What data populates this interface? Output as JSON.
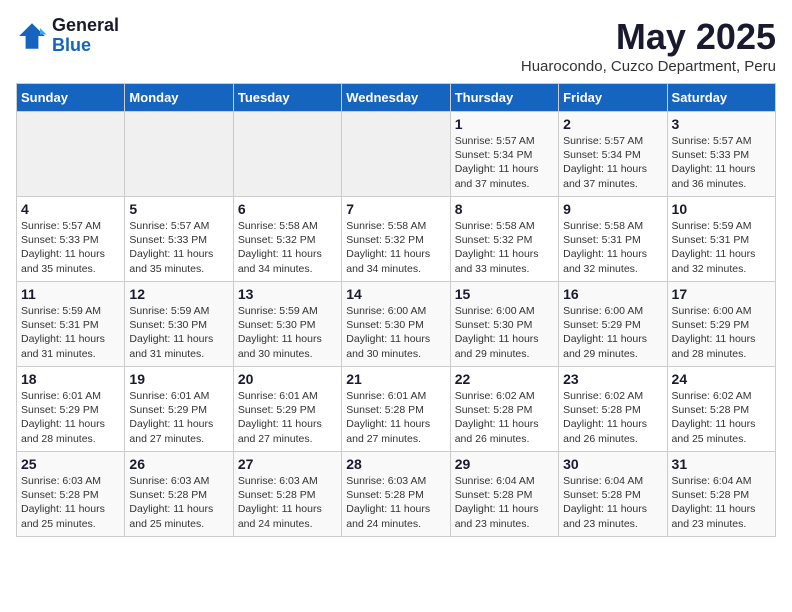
{
  "logo": {
    "general": "General",
    "blue": "Blue"
  },
  "header": {
    "month": "May 2025",
    "location": "Huarocondo, Cuzco Department, Peru"
  },
  "weekdays": [
    "Sunday",
    "Monday",
    "Tuesday",
    "Wednesday",
    "Thursday",
    "Friday",
    "Saturday"
  ],
  "weeks": [
    [
      {
        "day": "",
        "info": ""
      },
      {
        "day": "",
        "info": ""
      },
      {
        "day": "",
        "info": ""
      },
      {
        "day": "",
        "info": ""
      },
      {
        "day": "1",
        "info": "Sunrise: 5:57 AM\nSunset: 5:34 PM\nDaylight: 11 hours\nand 37 minutes."
      },
      {
        "day": "2",
        "info": "Sunrise: 5:57 AM\nSunset: 5:34 PM\nDaylight: 11 hours\nand 37 minutes."
      },
      {
        "day": "3",
        "info": "Sunrise: 5:57 AM\nSunset: 5:33 PM\nDaylight: 11 hours\nand 36 minutes."
      }
    ],
    [
      {
        "day": "4",
        "info": "Sunrise: 5:57 AM\nSunset: 5:33 PM\nDaylight: 11 hours\nand 35 minutes."
      },
      {
        "day": "5",
        "info": "Sunrise: 5:57 AM\nSunset: 5:33 PM\nDaylight: 11 hours\nand 35 minutes."
      },
      {
        "day": "6",
        "info": "Sunrise: 5:58 AM\nSunset: 5:32 PM\nDaylight: 11 hours\nand 34 minutes."
      },
      {
        "day": "7",
        "info": "Sunrise: 5:58 AM\nSunset: 5:32 PM\nDaylight: 11 hours\nand 34 minutes."
      },
      {
        "day": "8",
        "info": "Sunrise: 5:58 AM\nSunset: 5:32 PM\nDaylight: 11 hours\nand 33 minutes."
      },
      {
        "day": "9",
        "info": "Sunrise: 5:58 AM\nSunset: 5:31 PM\nDaylight: 11 hours\nand 32 minutes."
      },
      {
        "day": "10",
        "info": "Sunrise: 5:59 AM\nSunset: 5:31 PM\nDaylight: 11 hours\nand 32 minutes."
      }
    ],
    [
      {
        "day": "11",
        "info": "Sunrise: 5:59 AM\nSunset: 5:31 PM\nDaylight: 11 hours\nand 31 minutes."
      },
      {
        "day": "12",
        "info": "Sunrise: 5:59 AM\nSunset: 5:30 PM\nDaylight: 11 hours\nand 31 minutes."
      },
      {
        "day": "13",
        "info": "Sunrise: 5:59 AM\nSunset: 5:30 PM\nDaylight: 11 hours\nand 30 minutes."
      },
      {
        "day": "14",
        "info": "Sunrise: 6:00 AM\nSunset: 5:30 PM\nDaylight: 11 hours\nand 30 minutes."
      },
      {
        "day": "15",
        "info": "Sunrise: 6:00 AM\nSunset: 5:30 PM\nDaylight: 11 hours\nand 29 minutes."
      },
      {
        "day": "16",
        "info": "Sunrise: 6:00 AM\nSunset: 5:29 PM\nDaylight: 11 hours\nand 29 minutes."
      },
      {
        "day": "17",
        "info": "Sunrise: 6:00 AM\nSunset: 5:29 PM\nDaylight: 11 hours\nand 28 minutes."
      }
    ],
    [
      {
        "day": "18",
        "info": "Sunrise: 6:01 AM\nSunset: 5:29 PM\nDaylight: 11 hours\nand 28 minutes."
      },
      {
        "day": "19",
        "info": "Sunrise: 6:01 AM\nSunset: 5:29 PM\nDaylight: 11 hours\nand 27 minutes."
      },
      {
        "day": "20",
        "info": "Sunrise: 6:01 AM\nSunset: 5:29 PM\nDaylight: 11 hours\nand 27 minutes."
      },
      {
        "day": "21",
        "info": "Sunrise: 6:01 AM\nSunset: 5:28 PM\nDaylight: 11 hours\nand 27 minutes."
      },
      {
        "day": "22",
        "info": "Sunrise: 6:02 AM\nSunset: 5:28 PM\nDaylight: 11 hours\nand 26 minutes."
      },
      {
        "day": "23",
        "info": "Sunrise: 6:02 AM\nSunset: 5:28 PM\nDaylight: 11 hours\nand 26 minutes."
      },
      {
        "day": "24",
        "info": "Sunrise: 6:02 AM\nSunset: 5:28 PM\nDaylight: 11 hours\nand 25 minutes."
      }
    ],
    [
      {
        "day": "25",
        "info": "Sunrise: 6:03 AM\nSunset: 5:28 PM\nDaylight: 11 hours\nand 25 minutes."
      },
      {
        "day": "26",
        "info": "Sunrise: 6:03 AM\nSunset: 5:28 PM\nDaylight: 11 hours\nand 25 minutes."
      },
      {
        "day": "27",
        "info": "Sunrise: 6:03 AM\nSunset: 5:28 PM\nDaylight: 11 hours\nand 24 minutes."
      },
      {
        "day": "28",
        "info": "Sunrise: 6:03 AM\nSunset: 5:28 PM\nDaylight: 11 hours\nand 24 minutes."
      },
      {
        "day": "29",
        "info": "Sunrise: 6:04 AM\nSunset: 5:28 PM\nDaylight: 11 hours\nand 23 minutes."
      },
      {
        "day": "30",
        "info": "Sunrise: 6:04 AM\nSunset: 5:28 PM\nDaylight: 11 hours\nand 23 minutes."
      },
      {
        "day": "31",
        "info": "Sunrise: 6:04 AM\nSunset: 5:28 PM\nDaylight: 11 hours\nand 23 minutes."
      }
    ]
  ]
}
